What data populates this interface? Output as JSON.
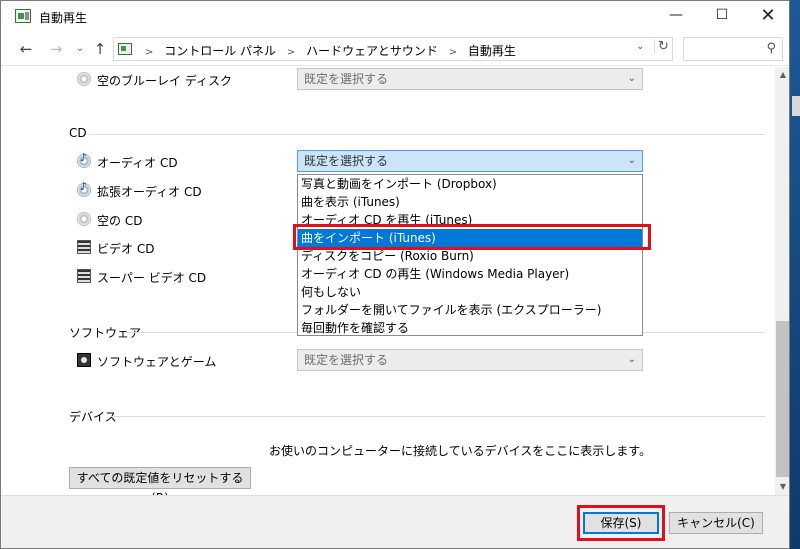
{
  "window": {
    "title": "自動再生"
  },
  "titlebar": {
    "minimize": "—",
    "maximize": "☐",
    "close": "✕"
  },
  "address": {
    "crumbs": [
      "コントロール パネル",
      "ハードウェアとサウンド",
      "自動再生"
    ],
    "chevron": "⌄",
    "refresh": "↻",
    "search_placeholder": ""
  },
  "default_choice": "既定を選択する",
  "blank_bluray": {
    "label": "空のブルーレイ ディスク",
    "value": "既定を選択する"
  },
  "cd_section": {
    "title": "CD",
    "items": [
      {
        "label": "オーディオ CD",
        "value": "既定を選択する"
      },
      {
        "label": "拡張オーディオ CD"
      },
      {
        "label": "空の CD"
      },
      {
        "label": "ビデオ CD"
      },
      {
        "label": "スーパー ビデオ CD"
      }
    ]
  },
  "dropdown": {
    "options": [
      "写真と動画をインポート (Dropbox)",
      "曲を表示 (iTunes)",
      "オーディオ CD を再生 (iTunes)",
      "曲をインポート (iTunes)",
      "ディスクをコピー (Roxio Burn)",
      "オーディオ CD の再生 (Windows Media Player)",
      "何もしない",
      "フォルダーを開いてファイルを表示 (エクスプローラー)",
      "毎回動作を確認する"
    ],
    "selected_index": 3
  },
  "software_section": {
    "title": "ソフトウェア",
    "item": {
      "label": "ソフトウェアとゲーム",
      "value": "既定を選択する"
    }
  },
  "device_section": {
    "title": "デバイス",
    "message": "お使いのコンピューターに接続しているデバイスをここに表示します。"
  },
  "reset_button": "すべての既定値をリセットする(R)",
  "footer": {
    "save": "保存(S)",
    "cancel": "キャンセル(C)"
  },
  "colors": {
    "accent": "#0078d7",
    "highlight_box": "#e0101e",
    "open_combo": "#cce4f7"
  }
}
